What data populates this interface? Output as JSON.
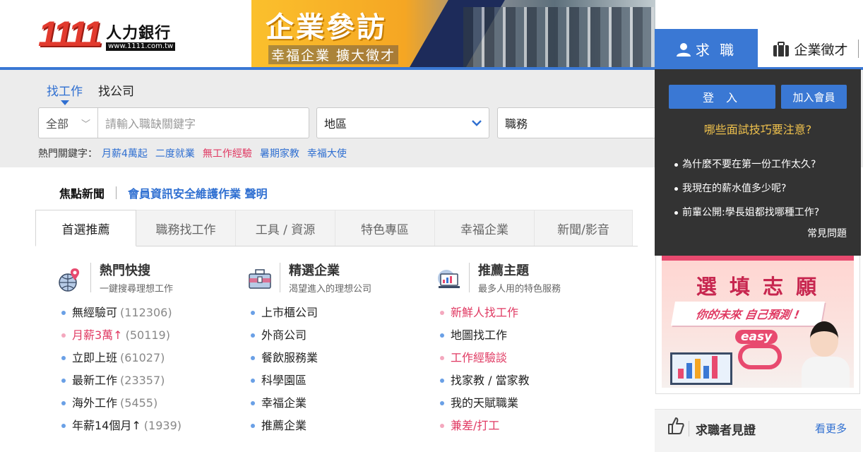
{
  "logo": {
    "number": "1111",
    "name": "人力銀行",
    "url": "www.1111.com.tw"
  },
  "banner": {
    "title": "企業參訪",
    "subtitle": "幸福企業 擴大徵才"
  },
  "top_tabs": {
    "job_seeker": "求 職",
    "employer": "企業徵才"
  },
  "search": {
    "tabs": [
      "找工作",
      "找公司"
    ],
    "category": "全部",
    "keyword_placeholder": "請輸入職缺關鍵字",
    "area": "地區",
    "job_type": "職務",
    "hot_label": "熱門關鍵字：",
    "hot_keywords": [
      "月薪4萬起",
      "二度就業",
      "無工作經驗",
      "暑期家教",
      "幸福大使"
    ]
  },
  "news": {
    "label": "焦點新聞",
    "link": "會員資訊安全維護作業 聲明"
  },
  "main_tabs": [
    "首選推薦",
    "職務找工作",
    "工具 / 資源",
    "特色專區",
    "幸福企業",
    "新聞/影音"
  ],
  "columns": [
    {
      "title": "熱門快搜",
      "subtitle": "一鍵搜尋理想工作",
      "items": [
        {
          "label": "無經驗可",
          "count": "(112306)"
        },
        {
          "label": "月薪3萬↑",
          "count": "(50119)"
        },
        {
          "label": "立即上班",
          "count": "(61027)"
        },
        {
          "label": "最新工作",
          "count": "(23357)"
        },
        {
          "label": "海外工作",
          "count": "(5455)"
        },
        {
          "label": "年薪14個月↑",
          "count": "(1939)"
        }
      ]
    },
    {
      "title": "精選企業",
      "subtitle": "渴望進入的理想公司",
      "items": [
        "上市櫃公司",
        "外商公司",
        "餐飲服務業",
        "科學園區",
        "幸福企業",
        "推薦企業"
      ]
    },
    {
      "title": "推薦主題",
      "subtitle": "最多人用的特色服務",
      "items": [
        "新鮮人找工作",
        "地圖找工作",
        "工作經驗談",
        "找家教 / 當家教",
        "我的天賦職業",
        "兼差/打工"
      ]
    }
  ],
  "login_panel": {
    "login": "登 入",
    "join": "加入會員",
    "question": "哪些面試技巧要注意?",
    "links": [
      "為什麼不要在第一份工作太久?",
      "我現在的薪水值多少呢?",
      "前輩公開:學長姐都找哪種工作?"
    ],
    "faq": "常見問題"
  },
  "ad": {
    "title": "選 填 志 願",
    "slogan": "你的未來 自己預測 !",
    "easy": "easy"
  },
  "testimonials": {
    "title": "求職者見證",
    "more": "看更多"
  },
  "colors": {
    "brand_blue": "#3a78d4",
    "link_blue": "#2f6fd1",
    "accent_red": "#e03a63",
    "panel_dark": "#333333",
    "gold": "#f0c24d"
  }
}
